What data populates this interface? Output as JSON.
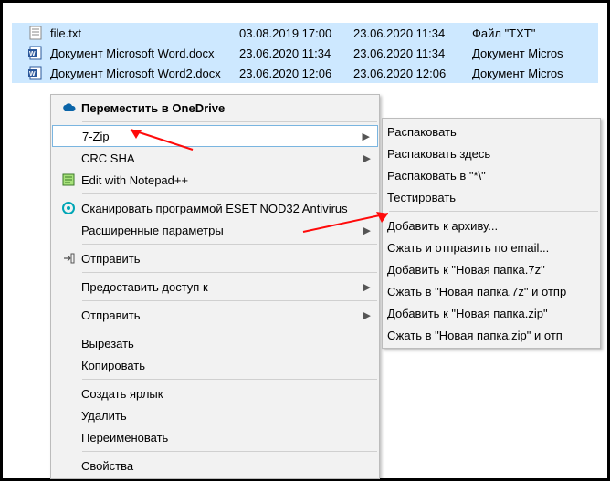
{
  "files": [
    {
      "name": "file.txt",
      "date1": "03.08.2019 17:00",
      "date2": "23.06.2020 11:34",
      "type": "Файл \"TXT\"",
      "icon": "txt"
    },
    {
      "name": "Документ Microsoft Word.docx",
      "date1": "23.06.2020 11:34",
      "date2": "23.06.2020 11:34",
      "type": "Документ Micros",
      "icon": "docx"
    },
    {
      "name": "Документ Microsoft Word2.docx",
      "date1": "23.06.2020 12:06",
      "date2": "23.06.2020 12:06",
      "type": "Документ Micros",
      "icon": "docx"
    }
  ],
  "menu1": {
    "onedrive": "Переместить в OneDrive",
    "sevenzip": "7-Zip",
    "crcsha": "CRC SHA",
    "editnpp": "Edit with Notepad++",
    "eset": "Сканировать программой ESET NOD32 Antivirus",
    "advparams": "Расширенные параметры",
    "sendto": "Отправить",
    "shareaccess": "Предоставить доступ к",
    "sendto2": "Отправить",
    "cut": "Вырезать",
    "copy": "Копировать",
    "shortcut": "Создать ярлык",
    "delete": "Удалить",
    "rename": "Переименовать",
    "properties": "Свойства"
  },
  "menu2": {
    "extract": "Распаковать",
    "extracthere": "Распаковать здесь",
    "extractto": "Распаковать в \"*\\\"",
    "test": "Тестировать",
    "addarchive": "Добавить к архиву...",
    "compressmail": "Сжать и отправить по email...",
    "add7z": "Добавить к \"Новая папка.7z\"",
    "compress7zmail": "Сжать в \"Новая папка.7z\" и отпр",
    "addzip": "Добавить к \"Новая папка.zip\"",
    "compresszipmail": "Сжать в \"Новая папка.zip\" и отп"
  }
}
